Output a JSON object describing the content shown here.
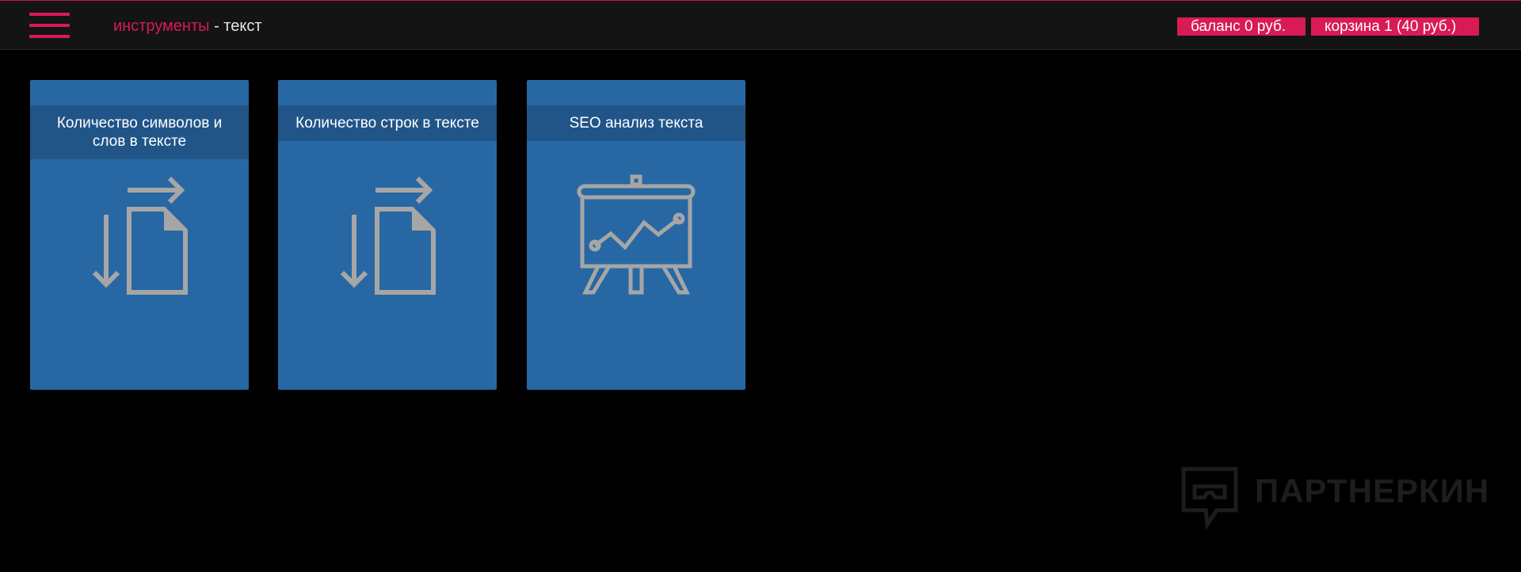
{
  "header": {
    "menu_icon": "hamburger-menu-icon",
    "breadcrumb": {
      "section": "инструменты",
      "separator": " - ",
      "current": "текст"
    },
    "balance_label": "баланс 0 руб.",
    "cart_label": "корзина 1 (40 руб.)"
  },
  "tools": [
    {
      "title": "Количество символов и слов в тексте",
      "icon": "document-transfer-icon"
    },
    {
      "title": "Количество строк в тексте",
      "icon": "document-transfer-icon"
    },
    {
      "title": "SEO анализ текста",
      "icon": "presentation-chart-icon"
    }
  ],
  "watermark": {
    "text": "ПАРТНЕРКИН",
    "icon": "chat-bubble-logo-icon"
  },
  "colors": {
    "accent": "#d81b55",
    "header_bg": "#141414",
    "page_bg": "#000000",
    "card_bg": "#2768a4",
    "card_title_bg": "#215588",
    "icon_color": "#a6a6a6"
  }
}
